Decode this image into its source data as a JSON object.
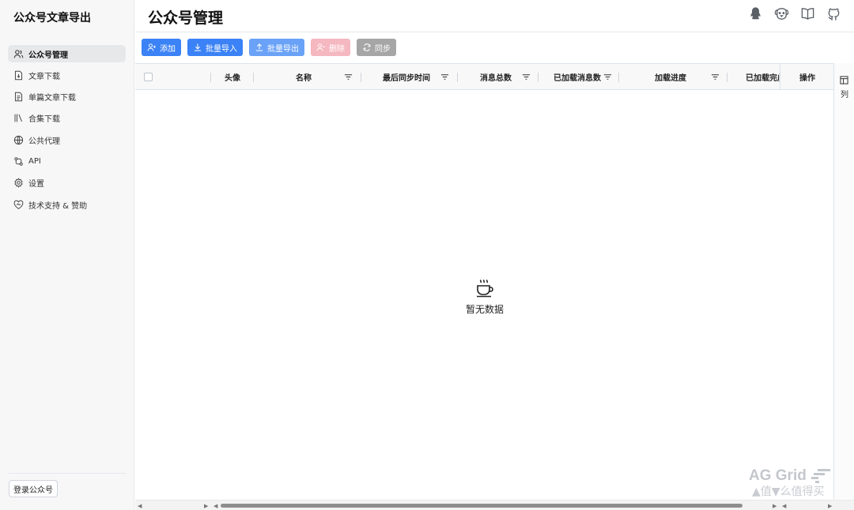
{
  "app": {
    "title": "公众号文章导出"
  },
  "sidebar": {
    "items": [
      {
        "label": "公众号管理",
        "icon": "users-icon",
        "active": true
      },
      {
        "label": "文章下载",
        "icon": "file-download-icon",
        "active": false
      },
      {
        "label": "单篇文章下载",
        "icon": "file-text-icon",
        "active": false
      },
      {
        "label": "合集下载",
        "icon": "library-icon",
        "active": false
      },
      {
        "label": "公共代理",
        "icon": "globe-icon",
        "active": false
      },
      {
        "label": "API",
        "icon": "api-icon",
        "active": false
      },
      {
        "label": "设置",
        "icon": "gear-icon",
        "active": false
      },
      {
        "label": "技术支持 & 赞助",
        "icon": "heart-handshake-icon",
        "active": false
      }
    ],
    "login_label": "登录公众号"
  },
  "header": {
    "title": "公众号管理",
    "icons": [
      "qq-icon",
      "dog-icon",
      "book-icon",
      "github-icon"
    ]
  },
  "toolbar": {
    "add_label": "添加",
    "import_label": "批量导入",
    "export_label": "批量导出",
    "delete_label": "删除",
    "sync_label": "同步"
  },
  "grid": {
    "columns": [
      "头像",
      "名称",
      "最后同步时间",
      "消息总数",
      "已加载消息数",
      "加载进度",
      "已加载完成",
      "操作"
    ],
    "column_panel_label": "列",
    "empty_text": "暂无数据",
    "rows": []
  },
  "watermark": {
    "text": "AG Grid",
    "sub": "▲值▼么值得买"
  },
  "colors": {
    "primary": "#3b82f6",
    "primary_light": "#6aa2f7",
    "danger_disabled": "#f5b7c0",
    "gray": "#a6a6a6"
  }
}
